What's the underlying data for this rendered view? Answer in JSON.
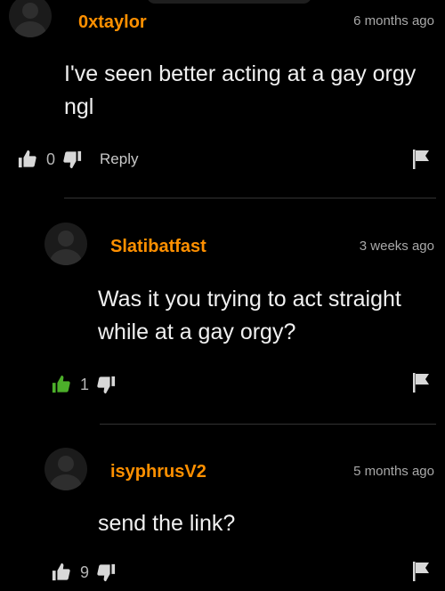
{
  "comments": [
    {
      "username": "0xtaylor",
      "time": "6 months ago",
      "text": "I've seen better acting at a gay orgy ngl",
      "likes": "0",
      "reply_label": "Reply",
      "liked": false
    },
    {
      "username": "Slatibatfast",
      "time": "3 weeks ago",
      "text": "Was it you trying to act straight while at a gay orgy?",
      "likes": "1",
      "liked": true
    },
    {
      "username": "isyphrusV2",
      "time": "5 months ago",
      "text": "send the link?",
      "likes": "9",
      "liked": false
    }
  ],
  "colors": {
    "username": "#ff9000",
    "liked": "#4caf2a",
    "icon": "#d8d8d8"
  },
  "icons": {
    "like": "thumbs-up-icon",
    "dislike": "thumbs-down-icon",
    "report": "flag-icon"
  }
}
